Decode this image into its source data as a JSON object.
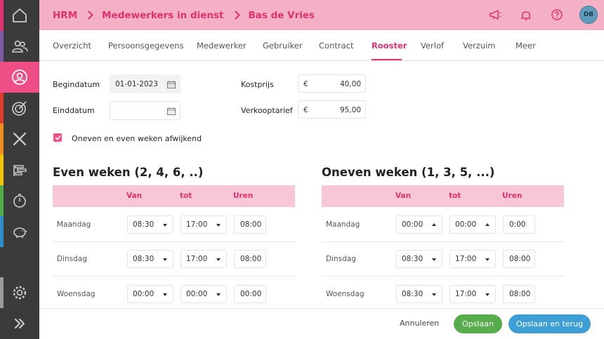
{
  "breadcrumb": {
    "items": [
      "HRM",
      "Medewerkers in dienst",
      "Bas de Vries"
    ]
  },
  "user": {
    "initials": "DB"
  },
  "tabs": [
    "Overzicht",
    "Persoonsgegevens",
    "Medewerker",
    "Gebruiker",
    "Contract",
    "Rooster",
    "Verlof",
    "Verzuim",
    "Meer"
  ],
  "active_tab": "Rooster",
  "form": {
    "begindatum_label": "Begindatum",
    "begindatum_value": "01-01-2023",
    "einddatum_label": "Einddatum",
    "einddatum_value": "",
    "kostprijs_label": "Kostprijs",
    "kostprijs_currency": "€",
    "kostprijs_value": "40,00",
    "verkooptarief_label": "Verkooptarief",
    "verkooptarief_currency": "€",
    "verkooptarief_value": "95,00",
    "checkbox_label": "Oneven en even weken afwijkend",
    "checkbox_checked": true
  },
  "even": {
    "title": "Even weken (2, 4, 6, ..)",
    "headers": [
      "Van",
      "tot",
      "Uren"
    ],
    "rows": [
      {
        "day": "Maandag",
        "van": "08:30",
        "tot": "17:00",
        "uren": "08:00"
      },
      {
        "day": "Dinsdag",
        "van": "08:30",
        "tot": "17:00",
        "uren": "08:00"
      },
      {
        "day": "Woensdag",
        "van": "00:00",
        "tot": "00:00",
        "uren": "00:00"
      }
    ]
  },
  "odd": {
    "title": "Oneven weken (1, 3, 5, ...)",
    "headers": [
      "Van",
      "tot",
      "Uren"
    ],
    "rows": [
      {
        "day": "Maandag",
        "van": "00:00",
        "tot": "00:00",
        "uren": "0:00"
      },
      {
        "day": "Dinsdag",
        "van": "08:30",
        "tot": "17:00",
        "uren": "08:00"
      },
      {
        "day": "Woensdag",
        "van": "08:30",
        "tot": "17:00",
        "uren": "08:00"
      }
    ]
  },
  "footer": {
    "cancel": "Annuleren",
    "save": "Opslaan",
    "save_back": "Opslaan en terug"
  },
  "colors": {
    "accent": "#e0306f",
    "header_bg": "#f4b1c6",
    "table_header_bg": "#f8c7d6",
    "save_green": "#57ad4c",
    "save_blue": "#3d9fd6",
    "sidebar": "#3b3b3b"
  },
  "sidebar_icons": [
    "home-icon",
    "people-icon",
    "person-icon",
    "target-icon",
    "tools-icon",
    "gantt-icon",
    "stopwatch-icon",
    "piggy-bank-icon",
    "gear-icon",
    "double-chevron-right-icon"
  ]
}
